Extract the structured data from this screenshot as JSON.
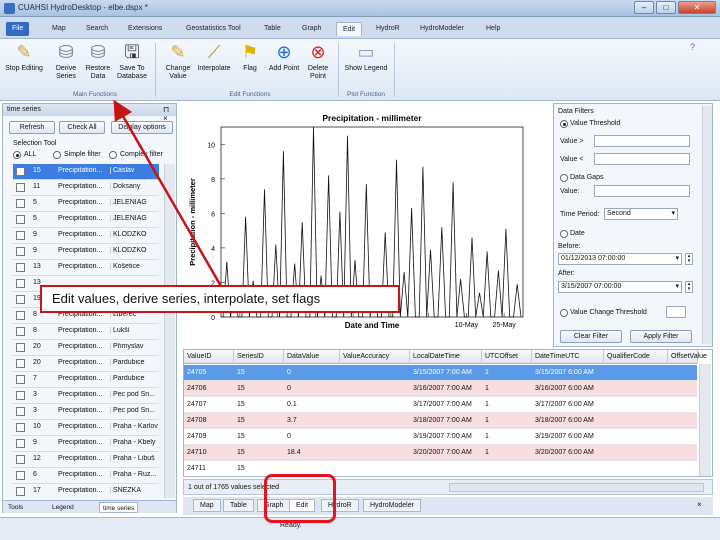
{
  "window": {
    "title": "CUAHSI HydroDesktop - elbe.dspx *"
  },
  "menu": {
    "tabs": [
      "File",
      "Map",
      "Search",
      "Extensions",
      "Geostatistics Tool",
      "Table",
      "Graph",
      "Edit",
      "HydroR",
      "HydroModeler",
      "Help"
    ],
    "active": "Edit"
  },
  "ribbon": {
    "buttons": [
      {
        "l1": "Stop Editing",
        "l2": ""
      },
      {
        "l1": "Derive",
        "l2": "Series"
      },
      {
        "l1": "Restore",
        "l2": "Data"
      },
      {
        "l1": "Save To",
        "l2": "Database"
      },
      {
        "l1": "Change",
        "l2": "Value"
      },
      {
        "l1": "Interpolate",
        "l2": ""
      },
      {
        "l1": "Flag",
        "l2": ""
      },
      {
        "l1": "Add Point",
        "l2": ""
      },
      {
        "l1": "Delete",
        "l2": "Point"
      },
      {
        "l1": "Show Legend",
        "l2": ""
      }
    ],
    "groups": [
      "Main Functions",
      "Edit Functions",
      "Plot Function"
    ]
  },
  "left_panel": {
    "title": "time series",
    "refresh_label": "Refresh",
    "check_all_label": "Check All",
    "options_label": "Display options",
    "selection_tool_label": "Selection Tool",
    "radio_all": "ALL",
    "radio_simple": "Simple filter",
    "radio_complex": "Complex filter",
    "rows": [
      {
        "checked": "✓",
        "id": "15",
        "name": "Precipitation...",
        "site": "Čáslav"
      },
      {
        "checked": "",
        "id": "11",
        "name": "Precipitation...",
        "site": "Doksany"
      },
      {
        "checked": "",
        "id": "5",
        "name": "Precipitation...",
        "site": "JELENIAG"
      },
      {
        "checked": "",
        "id": "5",
        "name": "Precipitation...",
        "site": "JELENIAG"
      },
      {
        "checked": "",
        "id": "9",
        "name": "Precipitation...",
        "site": "KLODZKO"
      },
      {
        "checked": "",
        "id": "9",
        "name": "Precipitation...",
        "site": "KLODZKO"
      },
      {
        "checked": "",
        "id": "13",
        "name": "Precipitation...",
        "site": "Košetice"
      },
      {
        "checked": "",
        "id": "13",
        "name": "",
        "site": ""
      },
      {
        "checked": "",
        "id": "19",
        "name": "",
        "site": ""
      },
      {
        "checked": "",
        "id": "8",
        "name": "Precipitation...",
        "site": "Liberec"
      },
      {
        "checked": "",
        "id": "8",
        "name": "Precipitation...",
        "site": "Lukší"
      },
      {
        "checked": "",
        "id": "20",
        "name": "Precipitation...",
        "site": "Přimyslav"
      },
      {
        "checked": "",
        "id": "20",
        "name": "Precipitation...",
        "site": "Pardubice"
      },
      {
        "checked": "",
        "id": "7",
        "name": "Precipitation...",
        "site": "Pardubice"
      },
      {
        "checked": "",
        "id": "3",
        "name": "Precipitation...",
        "site": "Pec pod Sn..."
      },
      {
        "checked": "",
        "id": "3",
        "name": "Precipitation...",
        "site": "Pec pod Sn..."
      },
      {
        "checked": "",
        "id": "10",
        "name": "Precipitation...",
        "site": "Praha - Karlov"
      },
      {
        "checked": "",
        "id": "9",
        "name": "Precipitation...",
        "site": "Praha - Kbely"
      },
      {
        "checked": "",
        "id": "12",
        "name": "Precipitation...",
        "site": "Praha - Libuš"
      },
      {
        "checked": "",
        "id": "6",
        "name": "Precipitation...",
        "site": "Praha - Ruz..."
      },
      {
        "checked": "",
        "id": "17",
        "name": "Precipitation...",
        "site": "SNEZKA"
      }
    ],
    "tabs": [
      "Tools",
      "Legend",
      "time series"
    ]
  },
  "chart_data": {
    "type": "line",
    "title": "Precipitation - millimeter",
    "xlabel": "Date and Time",
    "ylabel": "Precipitation - millimeter",
    "ylim": [
      0,
      11
    ],
    "yticks": [
      0,
      2,
      4,
      6,
      8,
      10
    ],
    "xticks": [
      "",
      "",
      "",
      "",
      "",
      "",
      "10-May",
      "25-May"
    ],
    "series": [
      {
        "name": "",
        "x": [
          0,
          1,
          2,
          3,
          4,
          5,
          6,
          7,
          8,
          9,
          10,
          11,
          12,
          13,
          14,
          15,
          16,
          17,
          18,
          19,
          20,
          21,
          22,
          23,
          24,
          25,
          26,
          27,
          28,
          29,
          30,
          31,
          32,
          33,
          34,
          35,
          36,
          37,
          38,
          39,
          40,
          41,
          42,
          43,
          44,
          45,
          46,
          47,
          48,
          49,
          50,
          51,
          52,
          53,
          54,
          55,
          56,
          57,
          58,
          59,
          60,
          61,
          62,
          63,
          64,
          65,
          66,
          67,
          68,
          69,
          70,
          71,
          72,
          73,
          74,
          75,
          76,
          77,
          78,
          79
        ],
        "values": [
          0,
          3.2,
          0,
          1.5,
          0,
          0,
          5.8,
          0,
          2.1,
          0,
          0,
          7.4,
          0,
          0,
          4.2,
          0,
          9.6,
          0,
          0,
          3.1,
          0,
          5.5,
          0,
          0,
          11.5,
          0,
          2.4,
          0,
          8.2,
          0,
          0,
          6.1,
          0,
          10.5,
          0,
          3.3,
          0,
          0,
          7.7,
          0,
          1.8,
          0,
          0,
          4.9,
          0,
          0,
          9.1,
          0,
          2.6,
          0,
          6.3,
          0,
          0,
          8.7,
          0,
          3.9,
          0,
          0,
          5.2,
          0,
          0,
          7.8,
          0,
          2.2,
          0,
          0,
          4.6,
          0,
          1.4,
          0,
          3.8,
          0,
          0,
          2.7,
          0,
          5.1,
          0,
          0,
          1.9,
          0
        ]
      }
    ]
  },
  "right_panel": {
    "title": "Data Filters",
    "value_threshold": "Value Threshold",
    "value_gt": "Value >",
    "value_lt": "Value <",
    "data_gaps": "Data Gaps",
    "value": "Value:",
    "time_period": "Time Period:",
    "time_period_value": "Second",
    "date": "Date",
    "before": "Before:",
    "before_value": "01/12/2013 07:00:00",
    "after": "After:",
    "after_value": "3/15/2007 07:00:00",
    "value_change_threshold": "Value Change Threshold",
    "clear_filter": "Clear Filter",
    "apply_filter": "Apply Filter"
  },
  "table": {
    "headers": [
      "ValueID",
      "SeriesID",
      "DataValue",
      "ValueAccuracy",
      "LocalDateTime",
      "UTCOffset",
      "DateTimeUTC",
      "QualifierCode",
      "OffsetValue"
    ],
    "rows": [
      [
        "24705",
        "15",
        "0",
        "",
        "3/15/2007 7:00 AM",
        "1",
        "3/15/2007 6:00 AM",
        "",
        ""
      ],
      [
        "24706",
        "15",
        "0",
        "",
        "3/16/2007 7:00 AM",
        "1",
        "3/16/2007 6:00 AM",
        "",
        ""
      ],
      [
        "24707",
        "15",
        "0.1",
        "",
        "3/17/2007 7:00 AM",
        "1",
        "3/17/2007 6:00 AM",
        "",
        ""
      ],
      [
        "24708",
        "15",
        "3.7",
        "",
        "3/18/2007 7:00 AM",
        "1",
        "3/18/2007 6:00 AM",
        "",
        ""
      ],
      [
        "24709",
        "15",
        "0",
        "",
        "3/19/2007 7:00 AM",
        "1",
        "3/19/2007 6:00 AM",
        "",
        ""
      ],
      [
        "24710",
        "15",
        "18.4",
        "",
        "3/20/2007 7:00 AM",
        "1",
        "3/20/2007 6:00 AM",
        "",
        ""
      ],
      [
        "24711",
        "15",
        "",
        "",
        "",
        "",
        "",
        "",
        ""
      ]
    ],
    "status": "1 out of 1765 values selected"
  },
  "bottom_tabs": [
    "Map",
    "Table",
    "Graph",
    "Edit",
    "HydroR",
    "HydroModeler"
  ],
  "statusbar": {
    "text": "Ready."
  },
  "annotation": {
    "callout": "Edit values, derive series, interpolate, set flags"
  },
  "colors": {
    "accent": "#2f6bc2",
    "highlight": "#e3141e",
    "selected_row": "#3b7de0"
  }
}
